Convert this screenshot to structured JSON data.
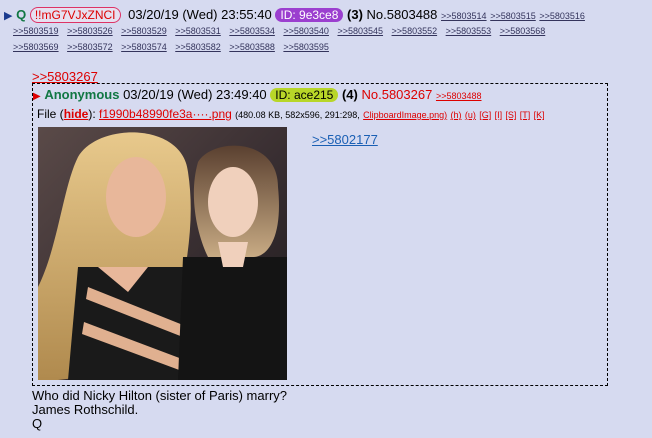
{
  "header": {
    "triangle": "▶",
    "name": "Q",
    "tripcode": "!!mG7VJxZNCI",
    "date": "03/20/19 (Wed) 23:55:40",
    "id": "ID: 9e3ce8",
    "count": "(3)",
    "post_no": "No.5803488",
    "inline_replies": [
      ">>5803514",
      ">>5803515",
      ">>5803516"
    ]
  },
  "replies_row1": [
    ">>5803519",
    ">>5803526",
    ">>5803529",
    ">>5803531",
    ">>5803534",
    ">>5803540",
    ">>5803545",
    ">>5803552",
    ">>5803553",
    ">>5803568"
  ],
  "replies_row2": [
    ">>5803569",
    ">>5803572",
    ">>5803574",
    ">>5803582",
    ">>5803588",
    ">>5803595"
  ],
  "quoted_link": ">>5803267",
  "quoted_post": {
    "name": "Anonymous",
    "date": "03/20/19 (Wed) 23:49:40",
    "id": "ID: ace215",
    "count": "(4)",
    "post_no": "No.5803267",
    "reply": ">>5803488",
    "file_label": "File",
    "hide": "hide",
    "file_name": "f1990b48990fe3a····.png",
    "file_meta": "(480.08 KB, 582x596, 291:298,",
    "file_orig": "ClipboardImage.png)",
    "file_tools": [
      "(h)",
      "(u)",
      "[G]",
      "[I]",
      "[S]",
      "[T]",
      "[K]"
    ],
    "backlink": ">>5802177"
  },
  "body_lines": [
    "Who did Nicky Hilton (sister of Paris) marry?",
    "James Rothschild.",
    "Q"
  ],
  "colors": {
    "background": "#d6daf0",
    "name_green": "#117743",
    "link_red": "#dd0000",
    "id_purple": "#9b3fcf",
    "id_green": "#b8d628"
  }
}
